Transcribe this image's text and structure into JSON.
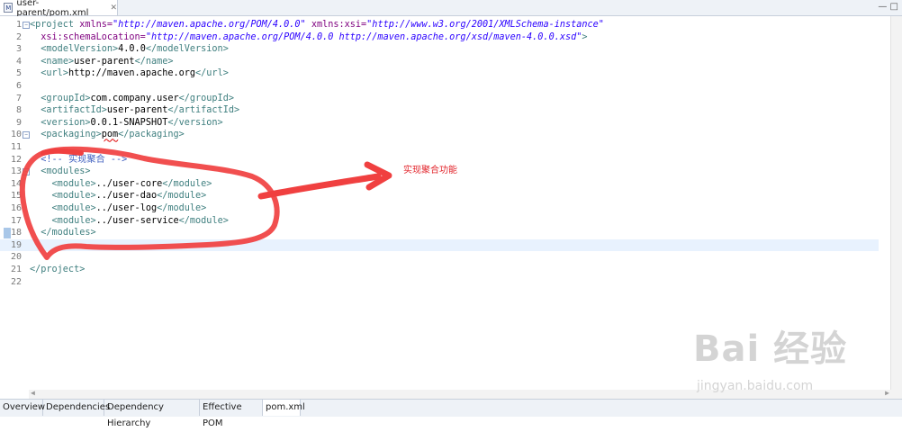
{
  "tab": {
    "title": "user-parent/pom.xml",
    "file_icon": "maven-pom-icon",
    "close_glyph": "✕"
  },
  "window_controls": {
    "minimize": "—",
    "maximize": "□"
  },
  "lines": [
    {
      "n": "1",
      "fold": "⊖",
      "parts": [
        [
          "t",
          "<project "
        ],
        [
          "a",
          "xmlns="
        ],
        [
          "s",
          "\"http://maven.apache.org/POM/4.0.0\""
        ],
        [
          "x",
          " "
        ],
        [
          "a",
          "xmlns:xsi="
        ],
        [
          "s",
          "\"http://www.w3.org/2001/XMLSchema-instance\""
        ]
      ]
    },
    {
      "n": "2",
      "parts": [
        [
          "x",
          "  "
        ],
        [
          "a",
          "xsi:schemaLocation="
        ],
        [
          "s",
          "\"http://maven.apache.org/POM/4.0.0 http://maven.apache.org/xsd/maven-4.0.0.xsd\""
        ],
        [
          "t",
          ">"
        ]
      ]
    },
    {
      "n": "3",
      "parts": [
        [
          "x",
          "  "
        ],
        [
          "t",
          "<modelVersion>"
        ],
        [
          "x",
          "4.0.0"
        ],
        [
          "t",
          "</modelVersion>"
        ]
      ]
    },
    {
      "n": "4",
      "parts": [
        [
          "x",
          "  "
        ],
        [
          "t",
          "<name>"
        ],
        [
          "x",
          "user-parent"
        ],
        [
          "t",
          "</name>"
        ]
      ]
    },
    {
      "n": "5",
      "parts": [
        [
          "x",
          "  "
        ],
        [
          "t",
          "<url>"
        ],
        [
          "x",
          "http://maven.apache.org"
        ],
        [
          "t",
          "</url>"
        ]
      ]
    },
    {
      "n": "6",
      "parts": []
    },
    {
      "n": "7",
      "parts": [
        [
          "x",
          "  "
        ],
        [
          "t",
          "<groupId>"
        ],
        [
          "x",
          "com.company.user"
        ],
        [
          "t",
          "</groupId>"
        ]
      ]
    },
    {
      "n": "8",
      "parts": [
        [
          "x",
          "  "
        ],
        [
          "t",
          "<artifactId>"
        ],
        [
          "x",
          "user-parent"
        ],
        [
          "t",
          "</artifactId>"
        ]
      ]
    },
    {
      "n": "9",
      "parts": [
        [
          "x",
          "  "
        ],
        [
          "t",
          "<version>"
        ],
        [
          "x",
          "0.0.1-SNAPSHOT"
        ],
        [
          "t",
          "</version>"
        ]
      ]
    },
    {
      "n": "10",
      "fold": "⊖",
      "parts": [
        [
          "x",
          "  "
        ],
        [
          "t",
          "<packaging>"
        ],
        [
          "x err",
          "pom"
        ],
        [
          "t",
          "</packaging>"
        ]
      ]
    },
    {
      "n": "11",
      "parts": []
    },
    {
      "n": "12",
      "parts": [
        [
          "x",
          "  "
        ],
        [
          "c",
          "<!-- 实现聚合 -->"
        ]
      ]
    },
    {
      "n": "13",
      "fold": "⊖",
      "parts": [
        [
          "x",
          "  "
        ],
        [
          "t",
          "<modules>"
        ]
      ]
    },
    {
      "n": "14",
      "parts": [
        [
          "x",
          "    "
        ],
        [
          "t",
          "<module>"
        ],
        [
          "x",
          "../user-core"
        ],
        [
          "t",
          "</module>"
        ]
      ]
    },
    {
      "n": "15",
      "parts": [
        [
          "x",
          "    "
        ],
        [
          "t",
          "<module>"
        ],
        [
          "x",
          "../user-dao"
        ],
        [
          "t",
          "</module>"
        ]
      ]
    },
    {
      "n": "16",
      "parts": [
        [
          "x",
          "    "
        ],
        [
          "t",
          "<module>"
        ],
        [
          "x",
          "../user-log"
        ],
        [
          "t",
          "</module>"
        ]
      ]
    },
    {
      "n": "17",
      "parts": [
        [
          "x",
          "    "
        ],
        [
          "t",
          "<module>"
        ],
        [
          "x",
          "../user-service"
        ],
        [
          "t",
          "</module>"
        ]
      ]
    },
    {
      "n": "18",
      "parts": [
        [
          "x",
          "  "
        ],
        [
          "t",
          "</modules>"
        ]
      ]
    },
    {
      "n": "19",
      "current": true,
      "parts": []
    },
    {
      "n": "20",
      "parts": []
    },
    {
      "n": "21",
      "parts": [
        [
          "t",
          "</project>"
        ]
      ]
    },
    {
      "n": "22",
      "parts": []
    }
  ],
  "bottom_tabs": [
    "Overview",
    "Dependencies",
    "Dependency Hierarchy",
    "Effective POM",
    "pom.xml"
  ],
  "active_bottom_tab": "pom.xml",
  "annotation": {
    "text": "实现聚合功能",
    "color": "#e2232a"
  },
  "watermark": {
    "text": "Bai 经验",
    "url": "jingyan.baidu.com"
  },
  "colors": {
    "tag": "#3f7f7f",
    "attr": "#7f007f",
    "string": "#2a00ff",
    "comment": "#3f5fbf",
    "current_line": "#e8f2fe"
  }
}
